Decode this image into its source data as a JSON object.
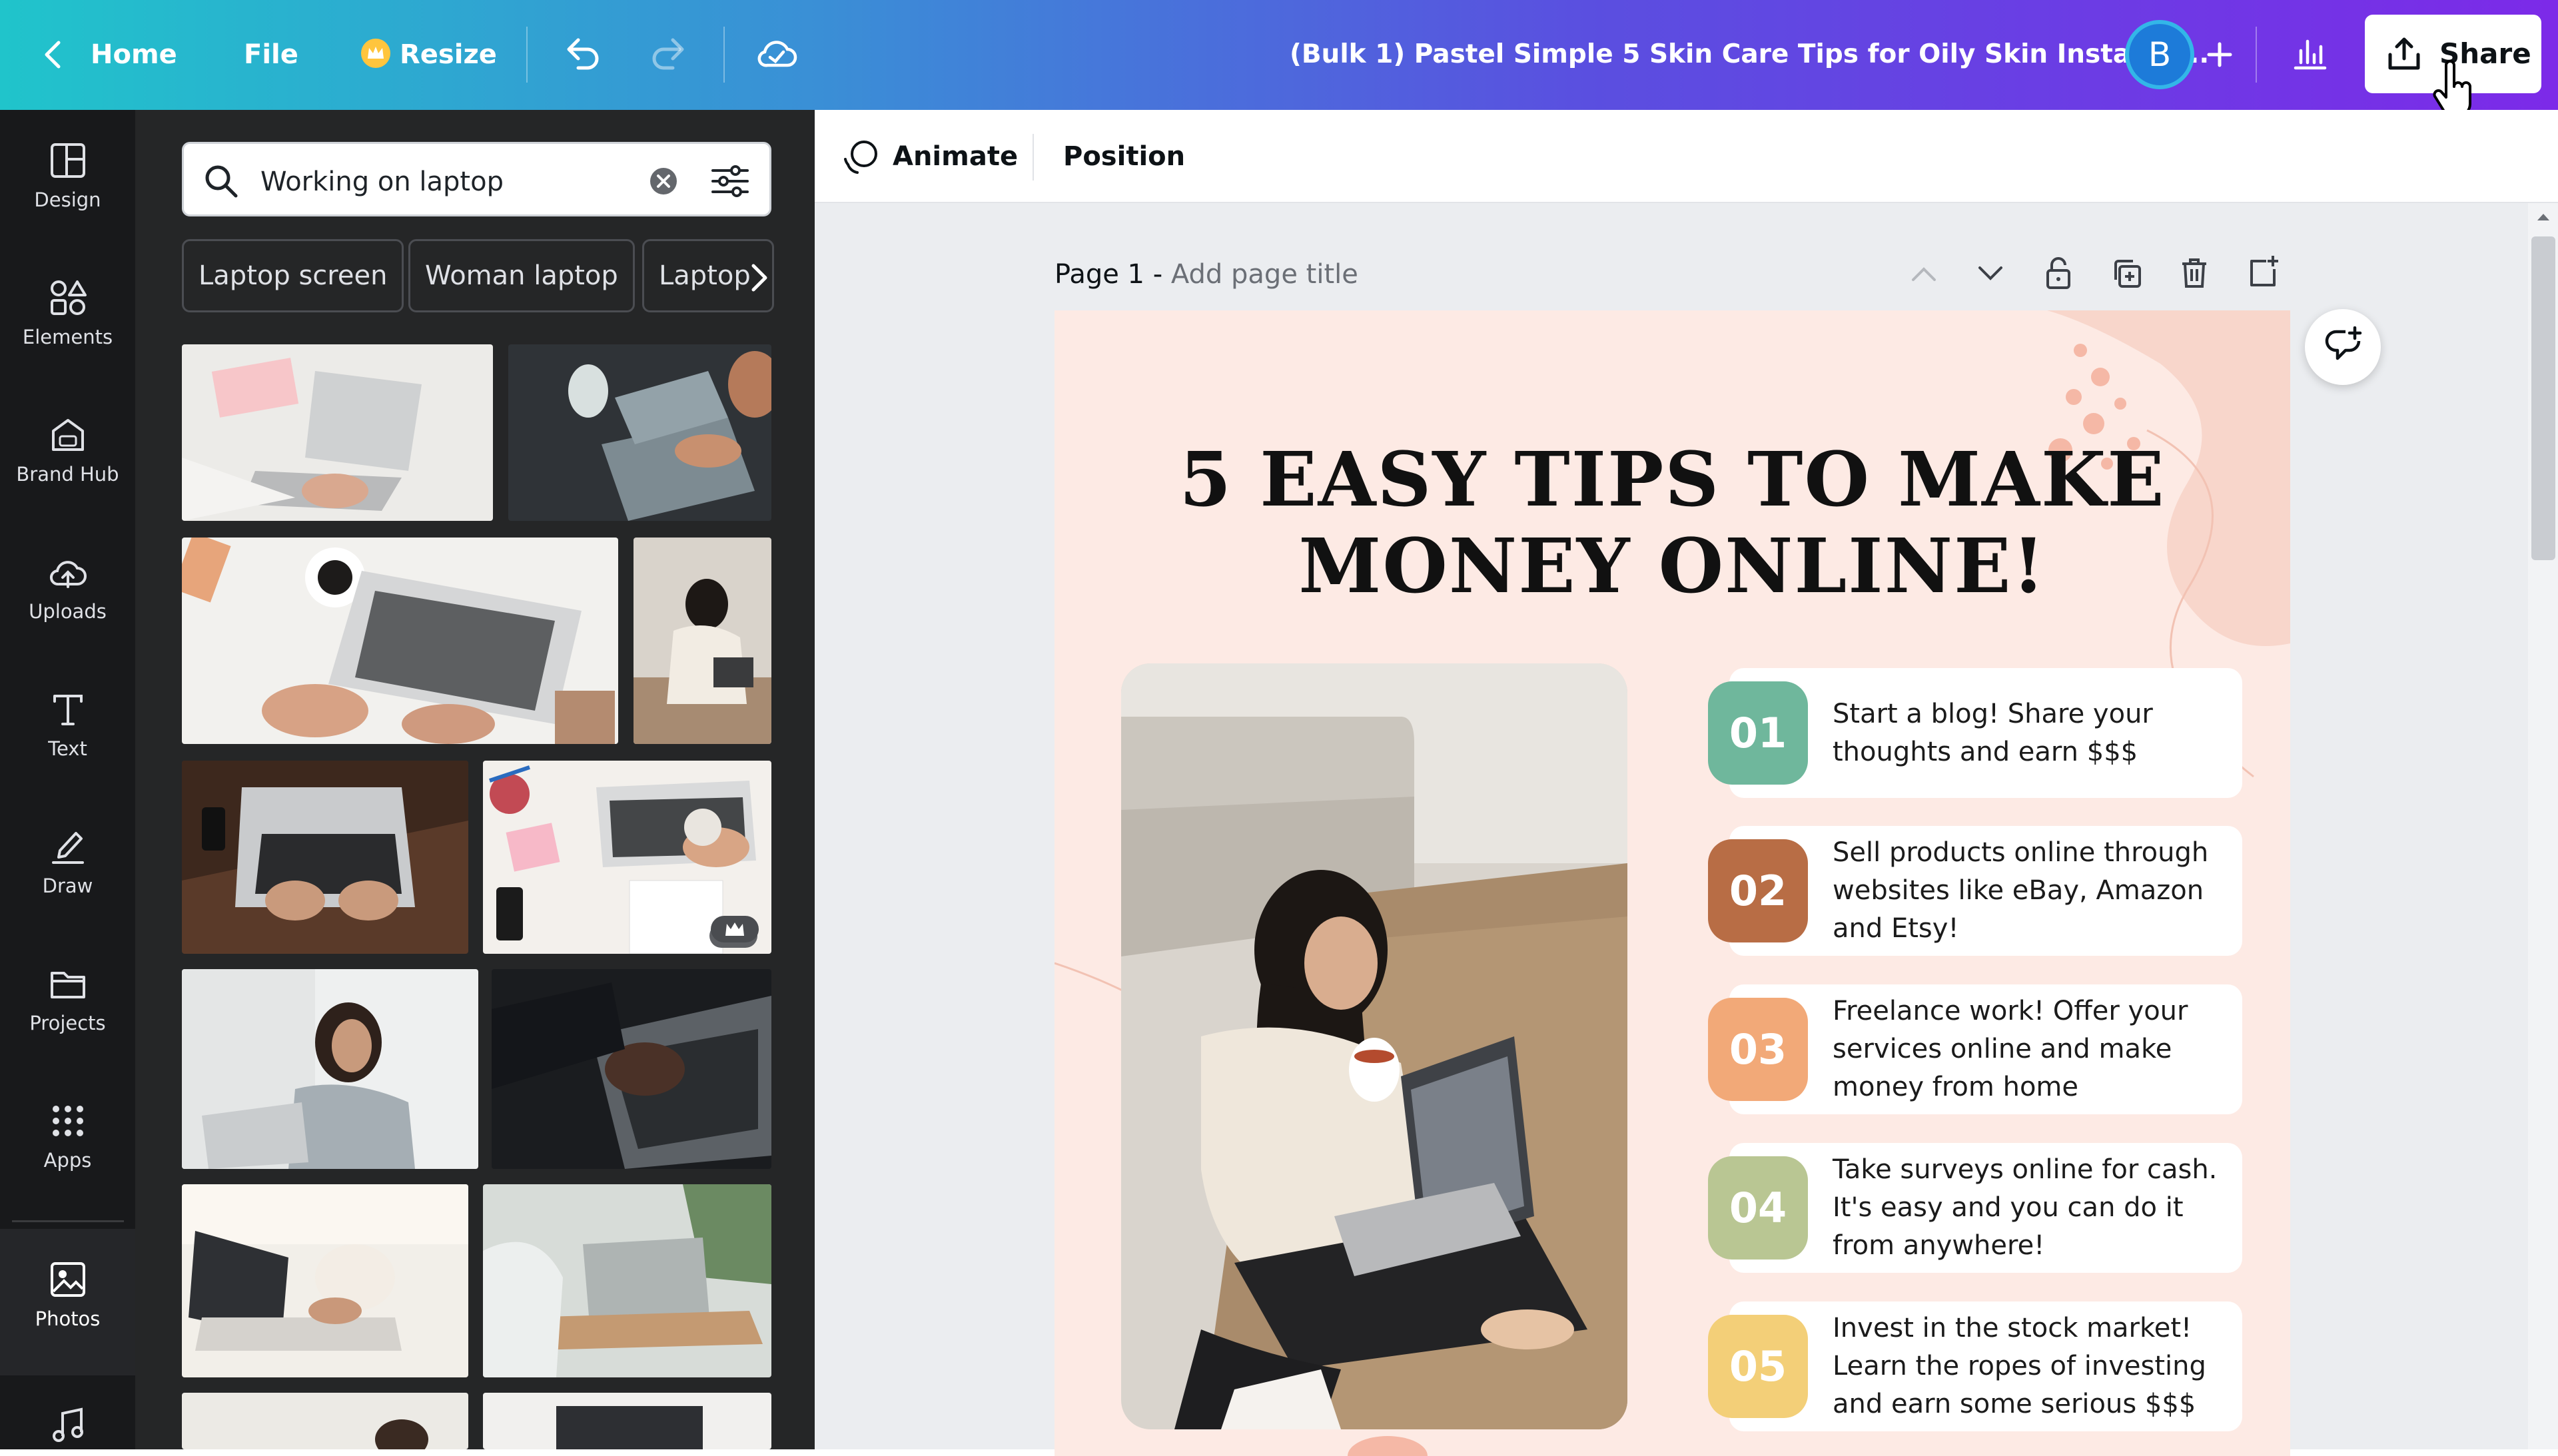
{
  "topbar": {
    "home_label": "Home",
    "file_label": "File",
    "resize_label": "Resize",
    "doc_title": "(Bulk 1) Pastel Simple 5 Skin Care Tips for Oily Skin Instagra...",
    "avatar_letter": "B",
    "share_label": "Share"
  },
  "rail": {
    "items": [
      {
        "label": "Design",
        "icon": "design-icon"
      },
      {
        "label": "Elements",
        "icon": "elements-icon"
      },
      {
        "label": "Brand Hub",
        "icon": "brand-hub-icon"
      },
      {
        "label": "Uploads",
        "icon": "upload-icon"
      },
      {
        "label": "Text",
        "icon": "text-icon"
      },
      {
        "label": "Draw",
        "icon": "draw-icon"
      },
      {
        "label": "Projects",
        "icon": "folder-icon"
      },
      {
        "label": "Apps",
        "icon": "apps-icon"
      },
      {
        "label": "Photos",
        "icon": "photos-icon"
      }
    ]
  },
  "panel": {
    "search_value": "Working on laptop",
    "chips": [
      "Laptop screen",
      "Woman laptop",
      "Laptop"
    ]
  },
  "toolbar": {
    "animate_label": "Animate",
    "position_label": "Position"
  },
  "page": {
    "number_label": "Page 1 -",
    "title_placeholder": "Add page title"
  },
  "design": {
    "heading_line1": "5 EASY TIPS TO MAKE",
    "heading_line2": "MONEY ONLINE!",
    "tips": [
      {
        "num": "01",
        "text": "Start a blog! Share your thoughts and earn $$$",
        "color": "#6fb79c"
      },
      {
        "num": "02",
        "text": "Sell products online through websites like eBay, Amazon and Etsy!",
        "color": "#b86d45"
      },
      {
        "num": "03",
        "text": "Freelance work! Offer your services online and make money from home",
        "color": "#f2a978"
      },
      {
        "num": "04",
        "text": "Take surveys online for cash. It's easy and you can do it from anywhere!",
        "color": "#b9c693"
      },
      {
        "num": "05",
        "text": "Invest in the stock market! Learn the ropes of investing and earn some serious $$$",
        "color": "#f3cf78"
      }
    ]
  },
  "colors": {
    "topbar_start": "#20c4cb",
    "topbar_end": "#7c2ae8",
    "page_bg": "#fdeae4"
  }
}
